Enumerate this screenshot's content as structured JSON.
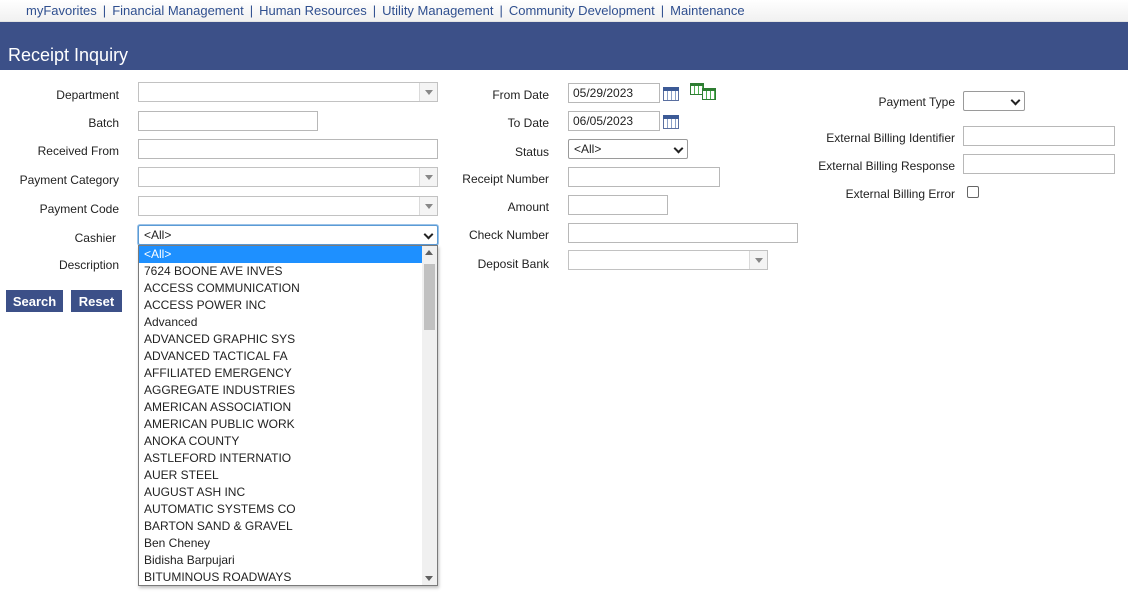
{
  "nav": {
    "items": [
      "myFavorites",
      "Financial Management",
      "Human Resources",
      "Utility Management",
      "Community Development",
      "Maintenance"
    ],
    "separator": "|"
  },
  "page": {
    "title": "Receipt Inquiry"
  },
  "form": {
    "left": {
      "department_label": "Department",
      "batch_label": "Batch",
      "received_from_label": "Received From",
      "payment_category_label": "Payment Category",
      "payment_code_label": "Payment Code",
      "cashier_label": "Cashier",
      "cashier_value": "<All>",
      "description_label": "Description"
    },
    "middle": {
      "from_date_label": "From Date",
      "from_date_value": "05/29/2023",
      "to_date_label": "To Date",
      "to_date_value": "06/05/2023",
      "status_label": "Status",
      "status_value": "<All>",
      "receipt_number_label": "Receipt Number",
      "amount_label": "Amount",
      "check_number_label": "Check Number",
      "deposit_bank_label": "Deposit Bank"
    },
    "right": {
      "payment_type_label": "Payment Type",
      "payment_type_value": "",
      "ext_billing_id_label": "External Billing Identifier",
      "ext_billing_response_label": "External Billing Response",
      "ext_billing_error_label": "External Billing Error"
    }
  },
  "buttons": {
    "search": "Search",
    "reset": "Reset"
  },
  "cashier_dropdown": {
    "options": [
      "<All>",
      "7624 BOONE AVE INVES",
      "ACCESS COMMUNICATION",
      "ACCESS POWER INC",
      "Advanced",
      "ADVANCED GRAPHIC SYS",
      "ADVANCED TACTICAL FA",
      "AFFILIATED EMERGENCY",
      "AGGREGATE INDUSTRIES",
      "AMERICAN ASSOCIATION",
      "AMERICAN PUBLIC WORK",
      "ANOKA COUNTY",
      "ASTLEFORD INTERNATIO",
      "AUER STEEL",
      "AUGUST ASH INC",
      "AUTOMATIC SYSTEMS CO",
      "BARTON SAND & GRAVEL",
      "Ben Cheney",
      "Bidisha Barpujari",
      "BITUMINOUS ROADWAYS"
    ],
    "selected": "<All>"
  },
  "icons": {
    "calendar": "calendar-icon",
    "multi_calendar": "multi-calendar-icon"
  },
  "colors": {
    "header_bg": "#3c5088",
    "nav_text": "#2f4f8f",
    "selected_option": "#1e90ff"
  }
}
